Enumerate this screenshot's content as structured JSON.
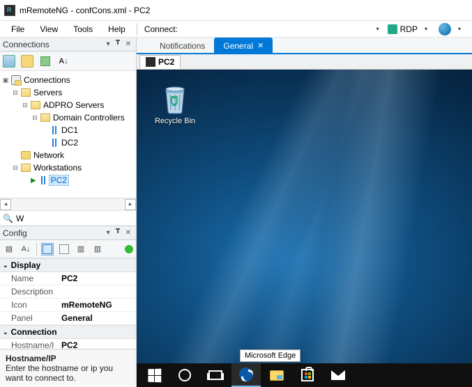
{
  "window": {
    "title": "mRemoteNG - confCons.xml - PC2"
  },
  "menu": {
    "file": "File",
    "view": "View",
    "tools": "Tools",
    "help": "Help",
    "connect": "Connect:",
    "rdp": "RDP"
  },
  "panels": {
    "connections": {
      "title": "Connections"
    },
    "config": {
      "title": "Config"
    }
  },
  "tree": {
    "root": "Connections",
    "servers": "Servers",
    "adpro": "ADPRO Servers",
    "domain_controllers": "Domain Controllers",
    "dc1": "DC1",
    "dc2": "DC2",
    "network": "Network",
    "workstations": "Workstations",
    "pc2": "PC2"
  },
  "search": {
    "value": "W"
  },
  "config_sort": "A↓",
  "props": {
    "group_display": "Display",
    "name_label": "Name",
    "name_val": "PC2",
    "desc_label": "Description",
    "desc_val": "",
    "icon_label": "Icon",
    "icon_val": "mRemoteNG",
    "panel_label": "Panel",
    "panel_val": "General",
    "group_connection": "Connection",
    "host_label": "Hostname/I",
    "host_val": "PC2"
  },
  "help": {
    "title": "Hostname/IP",
    "body": "Enter the hostname or ip you want to connect to."
  },
  "tabs": {
    "notifications": "Notifications",
    "general": "General"
  },
  "session_tab": "PC2",
  "desktop": {
    "recycle_bin": "Recycle Bin",
    "tooltip": "Microsoft Edge"
  }
}
